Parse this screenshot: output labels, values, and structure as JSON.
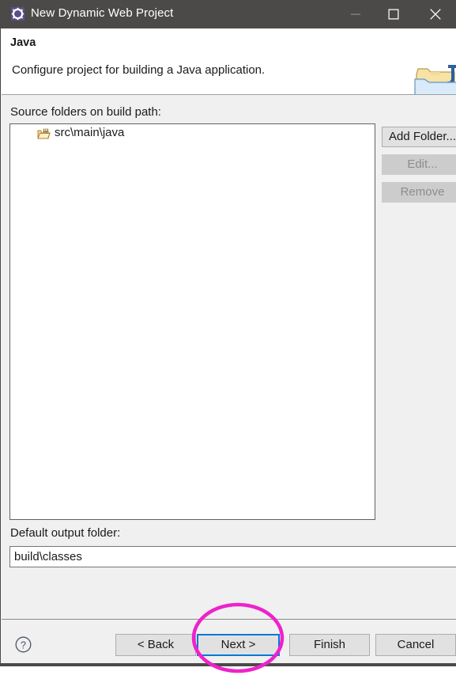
{
  "window": {
    "title": "New Dynamic Web Project",
    "icon": "eclipse-gear-icon",
    "controls": {
      "minimize_label": "minimize-icon",
      "maximize_label": "maximize-icon",
      "close_label": "close-icon"
    }
  },
  "header": {
    "title": "Java",
    "description": "Configure project for building a Java application.",
    "icon": "java-folder-icon"
  },
  "main": {
    "source_folders_label": "Source folders on build path:",
    "source_folders": [
      {
        "label": "src\\main\\java",
        "icon": "source-folder-icon"
      }
    ],
    "side_buttons": [
      {
        "label": "Add Folder...",
        "enabled": true
      },
      {
        "label": "Edit...",
        "enabled": false
      },
      {
        "label": "Remove",
        "enabled": false
      }
    ],
    "output_folder_label": "Default output folder:",
    "output_folder_value": "build\\classes",
    "output_folder_placeholder": ""
  },
  "footer": {
    "help_label": "?",
    "back_label": "< Back",
    "next_label": "Next >",
    "finish_label": "Finish",
    "cancel_label": "Cancel"
  },
  "annotation": {
    "shape": "ellipse",
    "color": "#ee22cc",
    "target": "Next >"
  },
  "colors": {
    "titlebar": "#4c4a48",
    "dialog_bg": "#f0f0f0",
    "header_bg": "#ffffff",
    "focus_border": "#0078d7",
    "annotation": "#ee22cc",
    "button_face": "#e1e1e1",
    "disabled_text": "#8d8d8d"
  }
}
